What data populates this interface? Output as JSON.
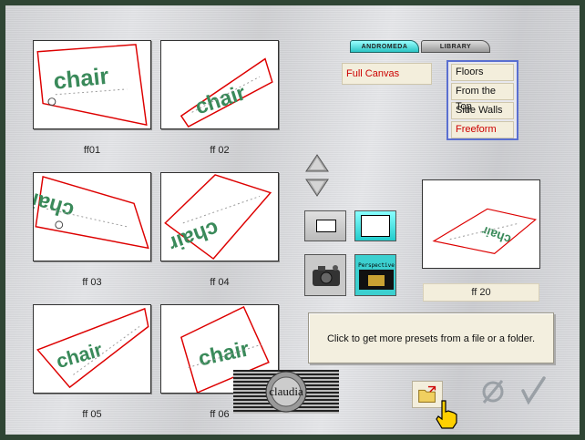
{
  "presets": {
    "items": [
      {
        "label": "ff01"
      },
      {
        "label": "ff 02"
      },
      {
        "label": "ff 03"
      },
      {
        "label": "ff 04"
      },
      {
        "label": "ff 05"
      },
      {
        "label": "ff 06"
      }
    ],
    "thumb_text": "chair"
  },
  "tabs": {
    "andromeda": "ANDROMEDA",
    "library": "LIBRARY"
  },
  "category": {
    "selected": "Full Canvas",
    "menu": [
      "Floors",
      "From the Top",
      "Side Walls",
      "Freeform"
    ]
  },
  "buttons": {
    "perspective_label": "Perspective"
  },
  "preview": {
    "label": "ff 20",
    "text": "chair"
  },
  "info": {
    "text": "Click to get more presets from a file or a folder."
  },
  "logo": {
    "text": "claudia"
  },
  "colors": {
    "accent_red": "#cc0000",
    "text_green": "#3a8a5a",
    "teal_tab": "#2ac4c4",
    "menu_border": "#5a6fd0",
    "frame": "#2f4534"
  }
}
